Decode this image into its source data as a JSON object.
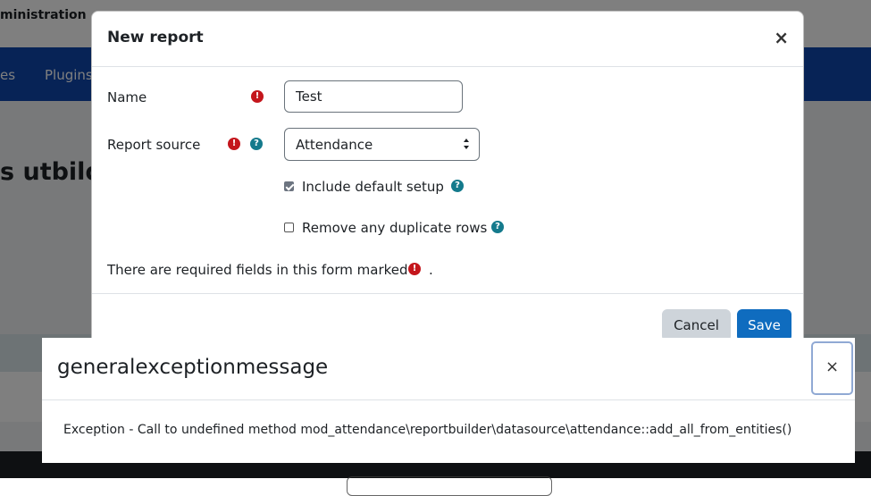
{
  "background": {
    "site_name": "ministration",
    "nav_items": [
      "es",
      "Plugins"
    ],
    "page_title": "s utbildn"
  },
  "new_report_modal": {
    "title": "New report",
    "close_symbol": "×",
    "name_label": "Name",
    "name_value": "Test",
    "report_source_label": "Report source",
    "report_source_value": "Attendance",
    "include_default_setup_label": "Include default setup",
    "include_default_setup_checked": true,
    "remove_duplicates_label": "Remove any duplicate rows",
    "remove_duplicates_checked": false,
    "required_note": "There are required fields in this form marked",
    "required_note_suffix": ".",
    "cancel_label": "Cancel",
    "save_label": "Save",
    "required_icon_glyph": "!",
    "help_icon_glyph": "?"
  },
  "exception_modal": {
    "title": "generalexceptionmessage",
    "close_symbol": "×",
    "message": "Exception - Call to undefined method mod_attendance\\reportbuilder\\datasource\\attendance::add_all_from_entities()"
  },
  "colors": {
    "nav_blue": "#0f47ad",
    "primary": "#0f6cbf",
    "required_red": "#c4161c",
    "help_teal": "#147a8c"
  }
}
